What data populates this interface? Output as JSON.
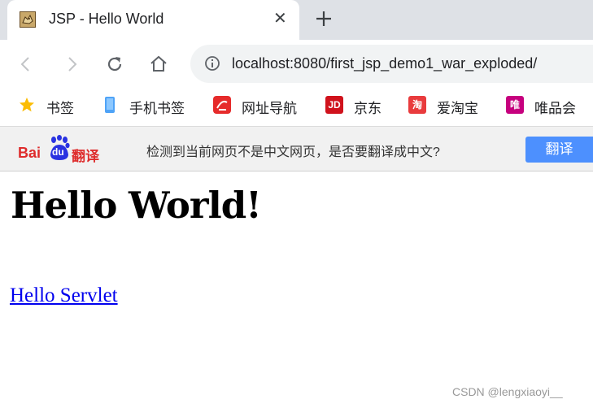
{
  "tab": {
    "title": "JSP - Hello World",
    "close_glyph": "✕",
    "favicon": "tomcat-icon"
  },
  "toolbar": {
    "url": "localhost:8080/first_jsp_demo1_war_exploded/"
  },
  "bookmarks": [
    {
      "label": "书签",
      "icon": "star-icon",
      "color": "#fbbc04"
    },
    {
      "label": "手机书签",
      "icon": "phone-icon",
      "color": "#4fa3f7"
    },
    {
      "label": "网址导航",
      "icon": "navigation-icon",
      "color": "#e62b2b"
    },
    {
      "label": "京东",
      "icon": "jd-icon",
      "icon_text": "JD",
      "color": "#d0121c"
    },
    {
      "label": "爱淘宝",
      "icon": "taobao-icon",
      "icon_text": "淘",
      "color": "#e93b3d"
    },
    {
      "label": "唯品会",
      "icon": "vip-icon",
      "icon_text": "唯",
      "color": "#c6007e"
    }
  ],
  "translate": {
    "brand_bai": "Bai",
    "brand_du": "du",
    "brand_fanyi": "翻译",
    "message": "检测到当前网页不是中文网页，是否要翻译成中文?",
    "button": "翻译",
    "button_color": "#4d90fe"
  },
  "page": {
    "heading": "Hello World!",
    "link": "Hello Servlet"
  },
  "watermark": "CSDN @lengxiaoyi__"
}
